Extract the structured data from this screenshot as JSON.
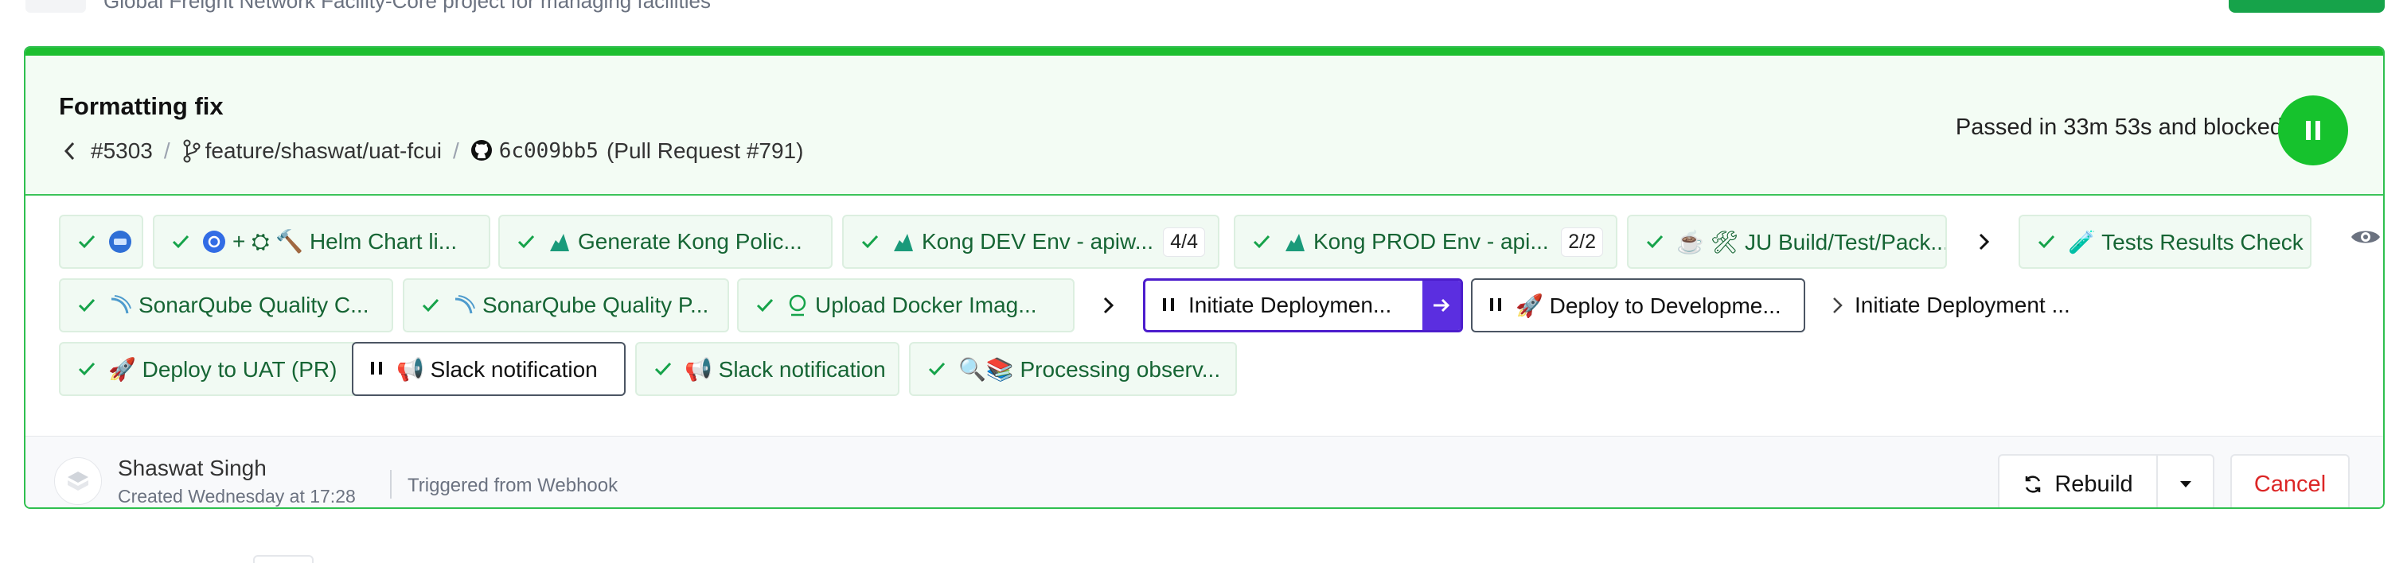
{
  "context": {
    "project_description": "Global Freight Network Facility-Core project for managing facilities"
  },
  "build": {
    "title": "Formatting fix",
    "number": "#5303",
    "branch": "feature/shaswat/uat-fcui",
    "commit": "6c009bb5",
    "pull_request": "(Pull Request #791)",
    "status_text": "Passed in 33m 53s and blocked",
    "status_color": "#16c22d",
    "accent_color": "#5b2ee0"
  },
  "jobs": {
    "row1": [
      {
        "label": "",
        "icon": "docker-icon",
        "state": "passed"
      },
      {
        "label": "+ ⛭ 🔨 Helm Chart li...",
        "icon": "kubernetes-icon",
        "state": "passed"
      },
      {
        "label": "Generate Kong Polic...",
        "icon": "kong-icon",
        "state": "passed"
      },
      {
        "label": "Kong DEV Env - apiw...",
        "icon": "kong-icon",
        "count": "4/4",
        "state": "passed"
      },
      {
        "label": "Kong PROD Env - api...",
        "icon": "kong-icon",
        "count": "2/2",
        "state": "passed"
      },
      {
        "label": "☕ 🛠 JU Build/Test/Pack...",
        "icon": "java-icon",
        "state": "passed"
      },
      {
        "label": "🧪 Tests Results Check",
        "icon": "test-tube-icon",
        "state": "passed"
      }
    ],
    "row2": [
      {
        "label": "SonarQube Quality C...",
        "icon": "sonarqube-icon",
        "state": "passed"
      },
      {
        "label": "SonarQube Quality P...",
        "icon": "sonarqube-icon",
        "state": "passed"
      },
      {
        "label": "Upload Docker Imag...",
        "icon": "upload-icon",
        "state": "passed"
      },
      {
        "label": "Initiate Deploymen...",
        "icon": "pause-icon",
        "state": "blocked-active"
      },
      {
        "label": "🚀 Deploy to Developme...",
        "icon": "pause-icon",
        "state": "blocked"
      },
      {
        "label": "Initiate Deployment ...",
        "icon": "chevron-right-icon",
        "state": "pending"
      }
    ],
    "row3": [
      {
        "label": "🚀 Deploy to UAT (PR)",
        "icon": "rocket-icon",
        "state": "passed"
      },
      {
        "label": "📢 Slack notification",
        "icon": "pause-icon",
        "state": "blocked"
      },
      {
        "label": "📢 Slack notification",
        "icon": "megaphone-icon",
        "state": "passed"
      },
      {
        "label": "🔍📚 Processing observ...",
        "icon": "magnifier-icon",
        "state": "passed"
      }
    ]
  },
  "footer": {
    "user_name": "Shaswat Singh",
    "created": "Created Wednesday at 17:28",
    "trigger": "Triggered from Webhook",
    "rebuild_label": "Rebuild",
    "cancel_label": "Cancel"
  }
}
